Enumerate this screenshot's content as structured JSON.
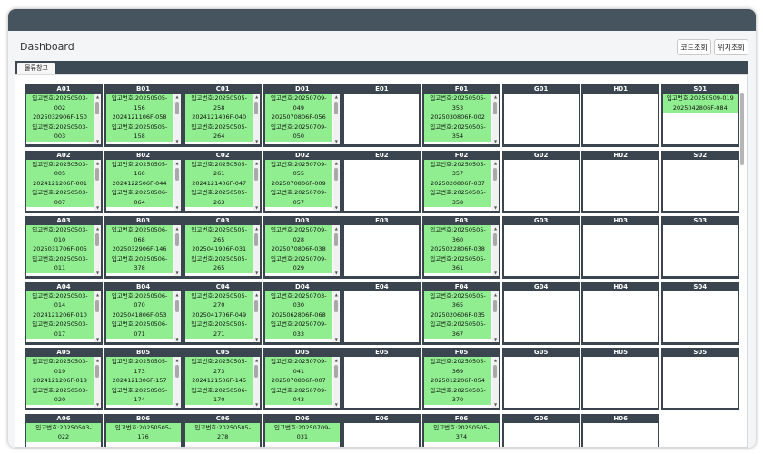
{
  "header": {
    "title": "Dashboard",
    "code_btn": "코드조회",
    "loc_btn": "위치조회"
  },
  "tabs": [
    {
      "label": "물류창고",
      "active": true
    }
  ],
  "colors": {
    "topbar": "#46545f",
    "cell_header": "#3a4550",
    "item": "#90ee90"
  },
  "prefix": "입고번호:",
  "rows": [
    {
      "cells": [
        {
          "label": "A01",
          "items": [
            [
              "입고번호:20250503-",
              "002"
            ],
            [
              "2025032906F-150"
            ],
            [
              "입고번호:20250503-",
              "003"
            ]
          ],
          "scroll": true
        },
        {
          "label": "B01",
          "items": [
            [
              "입고번호:20250505-",
              "156"
            ],
            [
              "2024121106F-058"
            ],
            [
              "입고번호:20250505-",
              "158"
            ]
          ],
          "scroll": true
        },
        {
          "label": "C01",
          "items": [
            [
              "입고번호:20250505-",
              "258"
            ],
            [
              "2024121406F-040"
            ],
            [
              "입고번호:20250505-",
              "264"
            ]
          ],
          "scroll": true
        },
        {
          "label": "D01",
          "items": [
            [
              "입고번호:20250709-",
              "049"
            ],
            [
              "2025070806F-056"
            ],
            [
              "입고번호:20250709-",
              "050"
            ]
          ],
          "scroll": true
        },
        {
          "label": "E01",
          "items": [],
          "scroll": false
        },
        {
          "label": "F01",
          "items": [
            [
              "입고번호:20250505-",
              "353"
            ],
            [
              "2025030806F-002"
            ],
            [
              "입고번호:20250505-",
              "354"
            ]
          ],
          "scroll": true
        },
        {
          "label": "G01",
          "items": [],
          "scroll": false
        },
        {
          "label": "H01",
          "items": [],
          "scroll": false
        },
        {
          "label": "S01",
          "items": [
            [
              "입고번호:20250509-019"
            ],
            [
              "2025042806F-084"
            ]
          ],
          "scroll": false
        }
      ]
    },
    {
      "cells": [
        {
          "label": "A02",
          "items": [
            [
              "입고번호:20250503-",
              "005"
            ],
            [
              "2024121206F-001"
            ],
            [
              "입고번호:20250503-",
              "007"
            ]
          ],
          "scroll": true
        },
        {
          "label": "B02",
          "items": [
            [
              "입고번호:20250505-",
              "160"
            ],
            [
              "2024122506F-044"
            ],
            [
              "입고번호:20250506-",
              "064"
            ]
          ],
          "scroll": true
        },
        {
          "label": "C02",
          "items": [
            [
              "입고번호:20250505-",
              "261"
            ],
            [
              "2024121406F-047"
            ],
            [
              "입고번호:20250505-",
              "263"
            ]
          ],
          "scroll": true
        },
        {
          "label": "D02",
          "items": [
            [
              "입고번호:20250709-",
              "055"
            ],
            [
              "2025070806F-009"
            ],
            [
              "입고번호:20250709-",
              "057"
            ]
          ],
          "scroll": true
        },
        {
          "label": "E02",
          "items": [],
          "scroll": false
        },
        {
          "label": "F02",
          "items": [
            [
              "입고번호:20250505-",
              "357"
            ],
            [
              "2025020806F-037"
            ],
            [
              "입고번호:20250505-",
              "358"
            ]
          ],
          "scroll": true
        },
        {
          "label": "G02",
          "items": [],
          "scroll": false
        },
        {
          "label": "H02",
          "items": [],
          "scroll": false
        },
        {
          "label": "S02",
          "items": [],
          "scroll": false
        }
      ]
    },
    {
      "cells": [
        {
          "label": "A03",
          "items": [
            [
              "입고번호:20250503-",
              "010"
            ],
            [
              "2025031706F-005"
            ],
            [
              "입고번호:20250503-",
              "011"
            ]
          ],
          "scroll": true
        },
        {
          "label": "B03",
          "items": [
            [
              "입고번호:20250506-",
              "068"
            ],
            [
              "2025032906F-146"
            ],
            [
              "입고번호:20250506-",
              "378"
            ]
          ],
          "scroll": true
        },
        {
          "label": "C03",
          "items": [
            [
              "입고번호:20250505-",
              "265"
            ],
            [
              "2025041906F-031"
            ],
            [
              "입고번호:20250505-",
              "265"
            ]
          ],
          "scroll": true
        },
        {
          "label": "D03",
          "items": [
            [
              "입고번호:20250709-",
              "028"
            ],
            [
              "2025070806F-038"
            ],
            [
              "입고번호:20250709-",
              "029"
            ]
          ],
          "scroll": true
        },
        {
          "label": "E03",
          "items": [],
          "scroll": false
        },
        {
          "label": "F03",
          "items": [
            [
              "입고번호:20250505-",
              "360"
            ],
            [
              "2025022806F-038"
            ],
            [
              "입고번호:20250505-",
              "361"
            ]
          ],
          "scroll": true
        },
        {
          "label": "G03",
          "items": [],
          "scroll": false
        },
        {
          "label": "H03",
          "items": [],
          "scroll": false
        },
        {
          "label": "S03",
          "items": [],
          "scroll": false
        }
      ]
    },
    {
      "cells": [
        {
          "label": "A04",
          "items": [
            [
              "입고번호:20250503-",
              "014"
            ],
            [
              "2024121206F-010"
            ],
            [
              "입고번호:20250503-",
              "017"
            ]
          ],
          "scroll": true
        },
        {
          "label": "B04",
          "items": [
            [
              "입고번호:20250506-",
              "070"
            ],
            [
              "2025041806F-053"
            ],
            [
              "입고번호:20250506-",
              "071"
            ]
          ],
          "scroll": true
        },
        {
          "label": "C04",
          "items": [
            [
              "입고번호:20250505-",
              "270"
            ],
            [
              "2025041706F-049"
            ],
            [
              "입고번호:20250505-",
              "271"
            ]
          ],
          "scroll": true
        },
        {
          "label": "D04",
          "items": [
            [
              "입고번호:20250703-",
              "030"
            ],
            [
              "2025062806F-068"
            ],
            [
              "입고번호:20250709-",
              "033"
            ]
          ],
          "scroll": true
        },
        {
          "label": "E04",
          "items": [],
          "scroll": false
        },
        {
          "label": "F04",
          "items": [
            [
              "입고번호:20250505-",
              "365"
            ],
            [
              "2025020606F-035"
            ],
            [
              "입고번호:20250505-",
              "367"
            ]
          ],
          "scroll": true
        },
        {
          "label": "G04",
          "items": [],
          "scroll": false
        },
        {
          "label": "H04",
          "items": [],
          "scroll": false
        },
        {
          "label": "S04",
          "items": [],
          "scroll": false
        }
      ]
    },
    {
      "cells": [
        {
          "label": "A05",
          "items": [
            [
              "입고번호:20250503-",
              "019"
            ],
            [
              "2024121206F-018"
            ],
            [
              "입고번호:20250503-",
              "020"
            ]
          ],
          "scroll": true
        },
        {
          "label": "B05",
          "items": [
            [
              "입고번호:20250505-",
              "173"
            ],
            [
              "2024121306F-157"
            ],
            [
              "입고번호:20250505-",
              "174"
            ]
          ],
          "scroll": true
        },
        {
          "label": "C05",
          "items": [
            [
              "입고번호:20250505-",
              "273"
            ],
            [
              "2024121506F-145"
            ],
            [
              "입고번호:20250506-",
              "170"
            ]
          ],
          "scroll": true
        },
        {
          "label": "D05",
          "items": [
            [
              "입고번호:20250709-",
              "041"
            ],
            [
              "2025070806F-007"
            ],
            [
              "입고번호:20250709-",
              "043"
            ]
          ],
          "scroll": true
        },
        {
          "label": "E05",
          "items": [],
          "scroll": false
        },
        {
          "label": "F05",
          "items": [
            [
              "입고번호:20250505-",
              "369"
            ],
            [
              "2025012206F-054"
            ],
            [
              "입고번호:20250505-",
              "370"
            ]
          ],
          "scroll": true
        },
        {
          "label": "G05",
          "items": [],
          "scroll": false
        },
        {
          "label": "H05",
          "items": [],
          "scroll": false
        },
        {
          "label": "S05",
          "items": [],
          "scroll": false
        }
      ]
    },
    {
      "cells": [
        {
          "label": "A06",
          "items": [
            [
              "입고번호:20250503-",
              "022"
            ]
          ],
          "scroll": false
        },
        {
          "label": "B06",
          "items": [
            [
              "입고번호:20250505-",
              "176"
            ]
          ],
          "scroll": false
        },
        {
          "label": "C06",
          "items": [
            [
              "입고번호:20250505-",
              "278"
            ]
          ],
          "scroll": false
        },
        {
          "label": "D06",
          "items": [
            [
              "입고번호:20250709-",
              "031"
            ]
          ],
          "scroll": false
        },
        {
          "label": "E06",
          "items": [],
          "scroll": false
        },
        {
          "label": "F06",
          "items": [
            [
              "입고번호:20250505-",
              "374"
            ]
          ],
          "scroll": false
        },
        {
          "label": "G06",
          "items": [],
          "scroll": false
        },
        {
          "label": "H06",
          "items": [],
          "scroll": false
        }
      ]
    }
  ]
}
